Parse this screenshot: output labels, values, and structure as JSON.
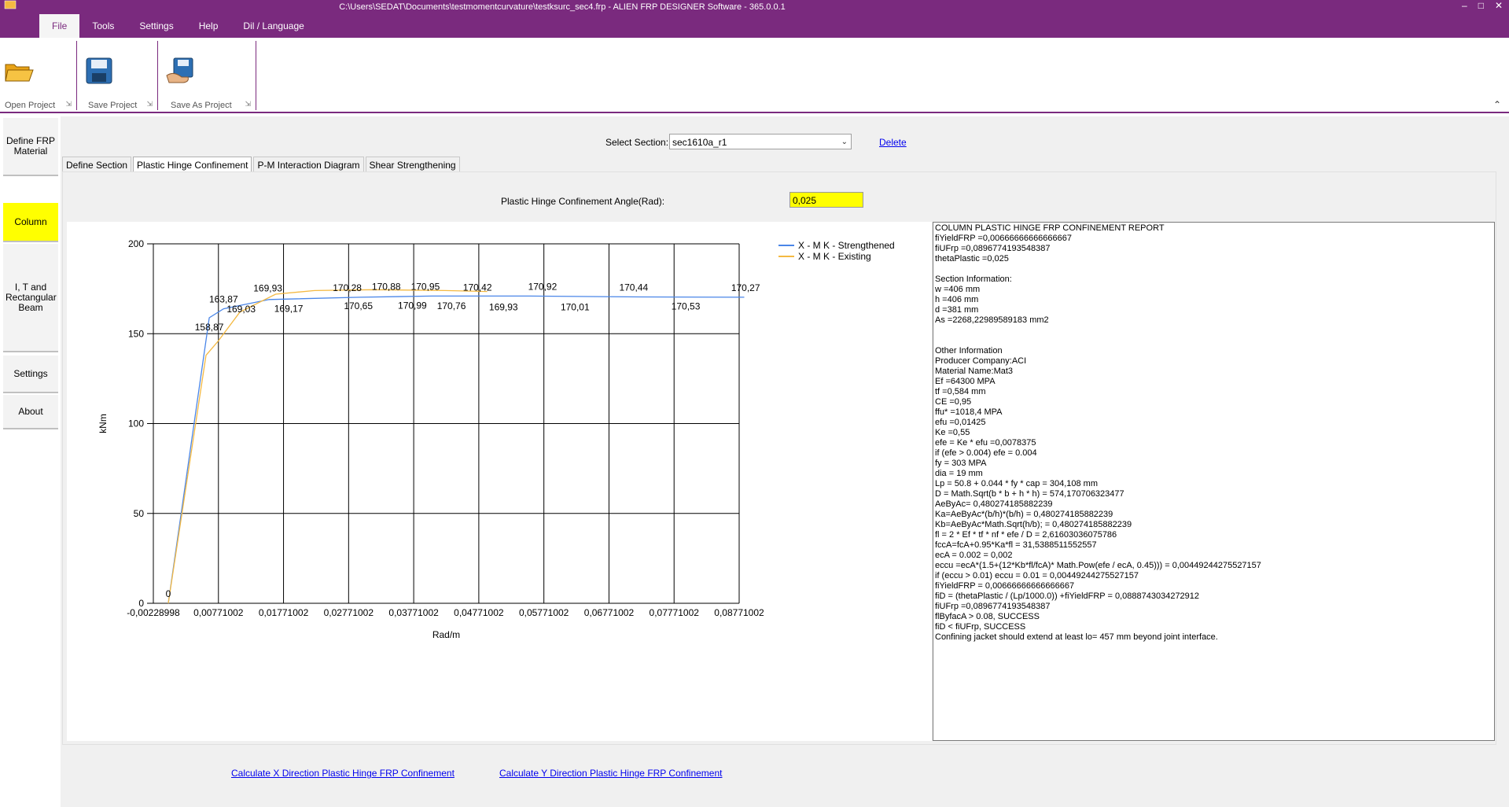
{
  "window": {
    "title": "C:\\Users\\SEDAT\\Documents\\testmomentcurvature\\testksurc_sec4.frp - ALIEN FRP DESIGNER Software - 365.0.0.1"
  },
  "menu": {
    "items": [
      "File",
      "Tools",
      "Settings",
      "Help",
      "Dil / Language"
    ]
  },
  "ribbon": {
    "open_label": "Open Project",
    "save_label": "Save Project",
    "saveas_label": "Save As Project"
  },
  "sidebar": {
    "items": [
      {
        "label": "Define FRP Material"
      },
      {
        "label": "Column"
      },
      {
        "label": "I, T and Rectangular Beam"
      },
      {
        "label": "Settings"
      },
      {
        "label": "About"
      }
    ]
  },
  "section": {
    "label": "Select Section:",
    "value": "sec1610a_r1",
    "delete_label": "Delete"
  },
  "tabs": [
    "Define Section",
    "Plastic Hinge Confinement",
    "P-M Interaction Diagram",
    "Shear Strengthening"
  ],
  "angle": {
    "label": "Plastic Hinge Confinement Angle(Rad):",
    "value": "0,025"
  },
  "chart_data": {
    "type": "line",
    "xlabel": "Rad/m",
    "ylabel": "kNm",
    "ylim": [
      0,
      200
    ],
    "xlim": [
      -0.00228998,
      0.08771002
    ],
    "x_ticks": [
      "-0,00228998",
      "0,00771002",
      "0,01771002",
      "0,02771002",
      "0,03771002",
      "0,04771002",
      "0,05771002",
      "0,06771002",
      "0,07771002",
      "0,08771002"
    ],
    "y_ticks": [
      "0",
      "50",
      "100",
      "150",
      "200"
    ],
    "grid": true,
    "legend_position": "top-right",
    "colors": {
      "strengthened": "#4a86e8",
      "existing": "#f4b942"
    },
    "series": [
      {
        "name": "X - M  K - Strengthened",
        "points": [
          [
            0,
            0
          ],
          [
            0.0063,
            158.87
          ],
          [
            0.0085,
            163.87
          ],
          [
            0.0155,
            169.03
          ],
          [
            0.0295,
            170.28
          ],
          [
            0.0405,
            170.95
          ],
          [
            0.0555,
            170.92
          ],
          [
            0.0725,
            170.44
          ],
          [
            0.0885,
            170.27
          ]
        ]
      },
      {
        "name": "X - M  K - Existing",
        "points": [
          [
            0,
            0
          ],
          [
            0.0058,
            138
          ],
          [
            0.0077,
            146
          ],
          [
            0.011,
            162
          ],
          [
            0.0165,
            172
          ],
          [
            0.0225,
            174
          ],
          [
            0.0315,
            174.5
          ],
          [
            0.0425,
            174
          ],
          [
            0.049,
            173.5
          ]
        ]
      }
    ],
    "data_labels": [
      {
        "text": "0",
        "x": 0,
        "y": 0
      },
      {
        "text": "158,87",
        "x": 0.0063,
        "y": 158.87
      },
      {
        "text": "163,87",
        "x": 0.0085,
        "y": 163.87
      },
      {
        "text": "169,03",
        "x": 0.0112,
        "y": 169.03
      },
      {
        "text": "169,93",
        "x": 0.0153,
        "y": 169.93
      },
      {
        "text": "169,17",
        "x": 0.0185,
        "y": 169.17
      },
      {
        "text": "170,28",
        "x": 0.0275,
        "y": 170.28
      },
      {
        "text": "170,65",
        "x": 0.0292,
        "y": 170.65
      },
      {
        "text": "170,88",
        "x": 0.0335,
        "y": 170.88
      },
      {
        "text": "170,99",
        "x": 0.0375,
        "y": 170.99
      },
      {
        "text": "170,95",
        "x": 0.0395,
        "y": 170.95
      },
      {
        "text": "170,76",
        "x": 0.0435,
        "y": 170.76
      },
      {
        "text": "170,42",
        "x": 0.0475,
        "y": 170.42
      },
      {
        "text": "169,93",
        "x": 0.0515,
        "y": 169.93
      },
      {
        "text": "170,92",
        "x": 0.0575,
        "y": 170.92
      },
      {
        "text": "170,01",
        "x": 0.0625,
        "y": 170.01
      },
      {
        "text": "170,44",
        "x": 0.0715,
        "y": 170.44
      },
      {
        "text": "170,53",
        "x": 0.0795,
        "y": 170.53
      },
      {
        "text": "170,27",
        "x": 0.0887,
        "y": 170.27
      }
    ]
  },
  "report": {
    "lines": [
      "COLUMN PLASTIC HINGE FRP CONFINEMENT REPORT",
      "fiYieldFRP =0,00666666666666667",
      "fiUFrp =0,0896774193548387",
      "thetaPlastic =0,025",
      "",
      "Section Information:",
      "w =406 mm",
      "h =406 mm",
      "d =381 mm",
      "As =2268,22989589183 mm2",
      "",
      "",
      "Other Information",
      "Producer Company:ACI",
      "Material Name:Mat3",
      "Ef =64300 MPA",
      "tf =0,584 mm",
      "CE =0,95",
      "ffu* =1018,4 MPA",
      "efu =0,01425",
      "Ke =0,55",
      "efe = Ke * efu =0,0078375",
      "if (efe > 0.004) efe = 0.004",
      "fy = 303 MPA",
      "dia = 19 mm",
      "Lp = 50.8 + 0.044 * fy * cap = 304,108 mm",
      "D = Math.Sqrt(b * b + h * h) = 574,170706323477",
      "AeByAc= 0,480274185882239",
      "Ka=AeByAc*(b/h)*(b/h) = 0,480274185882239",
      "Kb=AeByAc*Math.Sqrt(h/b); = 0,480274185882239",
      "fl = 2 * Ef * tf * nf * efe / D = 2,61603036075786",
      "fccA=fcA+0.95*Ka*fl = 31,5388511552557",
      "ecA = 0.002 = 0,002",
      "eccu =ecA*(1.5+(12*Kb*fl/fcA)* Math.Pow(efe / ecA, 0.45))) = 0,00449244275527157",
      "if (eccu > 0.01) eccu = 0.01 = 0,00449244275527157",
      "fiYieldFRP = 0,00666666666666667",
      "fiD = (thetaPlastic / (Lp/1000.0)) +fiYieldFRP = 0,0888743034272912",
      "fiUFrp =0,0896774193548387",
      "flByfacA > 0.08, SUCCESS",
      "fiD < fiUFrp, SUCCESS",
      "Confining jacket should extend at least lo= 457 mm beyond joint interface."
    ]
  },
  "calc": {
    "x_label": "Calculate X Direction Plastic Hinge FRP Confinement",
    "y_label": "Calculate Y Direction Plastic Hinge FRP Confinement"
  }
}
